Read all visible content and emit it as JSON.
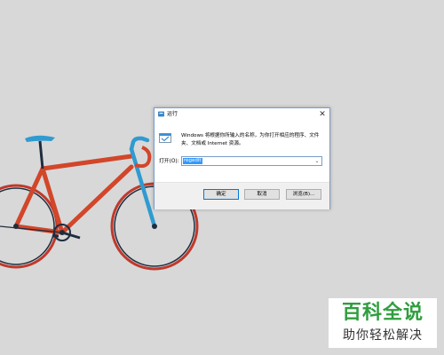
{
  "dialog": {
    "title": "运行",
    "description": "Windows 将根据你所输入的名称，为你打开相应的程序、文件夹、文档或 Internet 资源。",
    "open_label": "打开(O):",
    "input_value": "regedit",
    "buttons": {
      "ok": "确定",
      "cancel": "取消",
      "browse": "浏览(B)..."
    },
    "close_glyph": "✕",
    "dropdown_glyph": "⌄"
  },
  "watermark": {
    "main": "百科全说",
    "sub": "助你轻松解决",
    "color": "#2f9e3e"
  },
  "wallpaper": {
    "subject": "bicycle",
    "frame_color": "#d2462a",
    "fork_color": "#2f9bd0",
    "tire_color": "#c0392b"
  },
  "icons": {
    "title_icon": "run-icon",
    "body_icon": "run-program-icon"
  }
}
